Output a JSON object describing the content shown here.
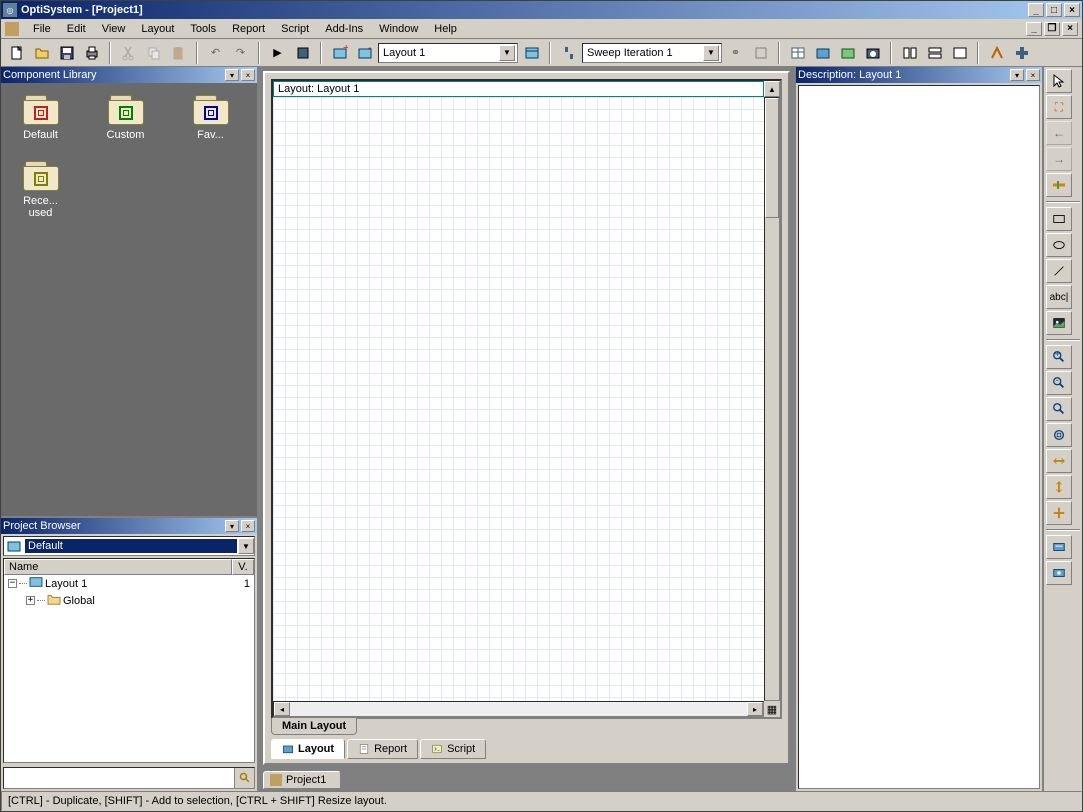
{
  "title": "OptiSystem - [Project1]",
  "menus": [
    "File",
    "Edit",
    "View",
    "Layout",
    "Tools",
    "Report",
    "Script",
    "Add-Ins",
    "Window",
    "Help"
  ],
  "toolbar": {
    "layout_combo": "Layout 1",
    "sweep_combo": "Sweep Iteration 1"
  },
  "component_library": {
    "title": "Component Library",
    "folders": [
      {
        "label": "Default",
        "color": "#c02020"
      },
      {
        "label": "Custom",
        "color": "#008000"
      },
      {
        "label": "Fav...",
        "color": "#0000a0"
      },
      {
        "label": "Rece...\nused",
        "color": "#808000"
      }
    ]
  },
  "project_browser": {
    "title": "Project Browser",
    "selected": "Default",
    "columns": {
      "name": "Name",
      "value": "V."
    },
    "rows": [
      {
        "label": "Layout 1",
        "value": "1",
        "depth": 0,
        "expander": "minus",
        "icon": "layout"
      },
      {
        "label": "Global",
        "value": "",
        "depth": 1,
        "expander": "plus",
        "icon": "folder"
      }
    ],
    "search_placeholder": ""
  },
  "canvas": {
    "title": "Layout: Layout 1",
    "tab": "Main Layout"
  },
  "view_tabs": [
    {
      "label": "Layout",
      "active": true
    },
    {
      "label": "Report",
      "active": false
    },
    {
      "label": "Script",
      "active": false
    }
  ],
  "doc_tab": "Project1",
  "description": {
    "title": "Description: Layout 1"
  },
  "statusbar": "[CTRL] - Duplicate, [SHIFT] - Add to selection, [CTRL + SHIFT] Resize layout."
}
